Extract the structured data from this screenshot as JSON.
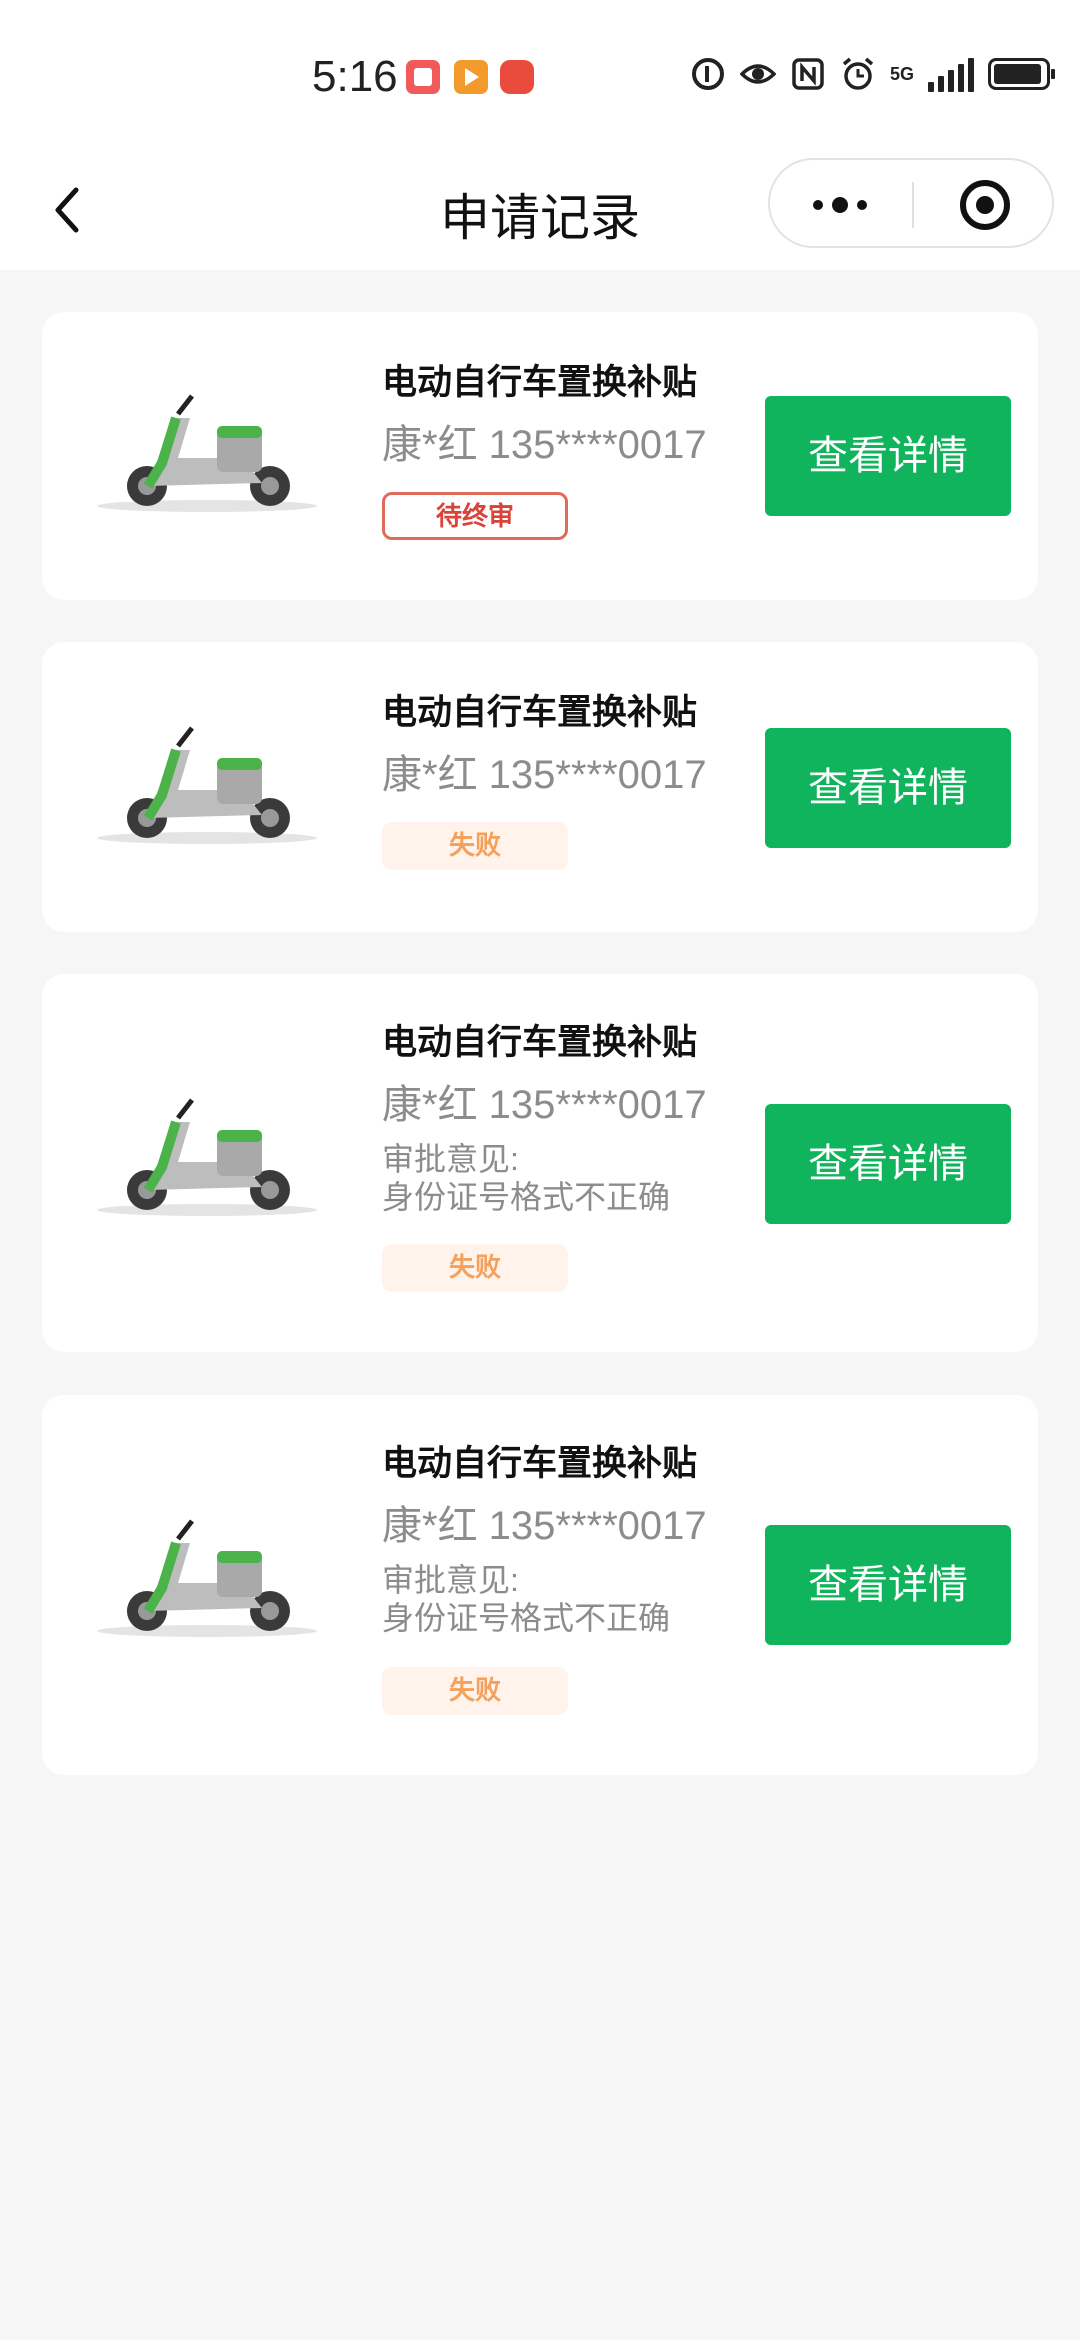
{
  "status_bar": {
    "time": "5:16",
    "network": "5G"
  },
  "nav": {
    "title": "申请记录",
    "back_icon": "chevron-left-icon",
    "menu_icon": "more-dots-icon",
    "close_icon": "target-circle-icon"
  },
  "colors": {
    "primary_button": "#0fb45c",
    "pending_badge": "#d9433a",
    "failed_badge": "#f3a15d"
  },
  "records": [
    {
      "title": "电动自行车置换补贴",
      "person": "康*红 135****0017",
      "remark_label": "",
      "remark_text": "",
      "status": "待终审",
      "button": "查看详情"
    },
    {
      "title": "电动自行车置换补贴",
      "person": "康*红 135****0017",
      "remark_label": "",
      "remark_text": "",
      "status": "失败",
      "button": "查看详情"
    },
    {
      "title": "电动自行车置换补贴",
      "person": "康*红 135****0017",
      "remark_label": "审批意见:",
      "remark_text": "身份证号格式不正确",
      "status": "失败",
      "button": "查看详情"
    },
    {
      "title": "电动自行车置换补贴",
      "person": "康*红 135****0017",
      "remark_label": "审批意见:",
      "remark_text": "身份证号格式不正确",
      "status": "失败",
      "button": "查看详情"
    }
  ]
}
